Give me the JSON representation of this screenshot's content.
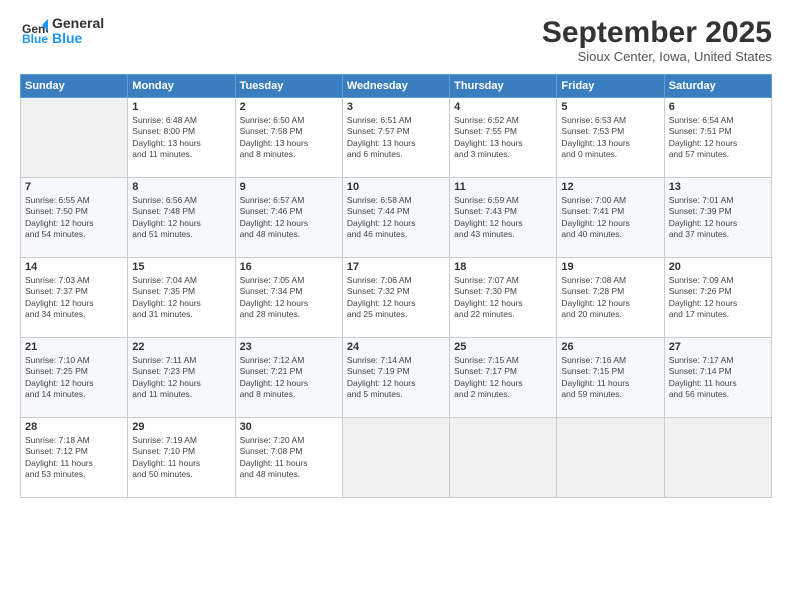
{
  "header": {
    "logo_line1": "General",
    "logo_line2": "Blue",
    "month_title": "September 2025",
    "subtitle": "Sioux Center, Iowa, United States"
  },
  "days_of_week": [
    "Sunday",
    "Monday",
    "Tuesday",
    "Wednesday",
    "Thursday",
    "Friday",
    "Saturday"
  ],
  "weeks": [
    [
      {
        "day": "",
        "info": ""
      },
      {
        "day": "1",
        "info": "Sunrise: 6:48 AM\nSunset: 8:00 PM\nDaylight: 13 hours\nand 11 minutes."
      },
      {
        "day": "2",
        "info": "Sunrise: 6:50 AM\nSunset: 7:58 PM\nDaylight: 13 hours\nand 8 minutes."
      },
      {
        "day": "3",
        "info": "Sunrise: 6:51 AM\nSunset: 7:57 PM\nDaylight: 13 hours\nand 6 minutes."
      },
      {
        "day": "4",
        "info": "Sunrise: 6:52 AM\nSunset: 7:55 PM\nDaylight: 13 hours\nand 3 minutes."
      },
      {
        "day": "5",
        "info": "Sunrise: 6:53 AM\nSunset: 7:53 PM\nDaylight: 13 hours\nand 0 minutes."
      },
      {
        "day": "6",
        "info": "Sunrise: 6:54 AM\nSunset: 7:51 PM\nDaylight: 12 hours\nand 57 minutes."
      }
    ],
    [
      {
        "day": "7",
        "info": "Sunrise: 6:55 AM\nSunset: 7:50 PM\nDaylight: 12 hours\nand 54 minutes."
      },
      {
        "day": "8",
        "info": "Sunrise: 6:56 AM\nSunset: 7:48 PM\nDaylight: 12 hours\nand 51 minutes."
      },
      {
        "day": "9",
        "info": "Sunrise: 6:57 AM\nSunset: 7:46 PM\nDaylight: 12 hours\nand 48 minutes."
      },
      {
        "day": "10",
        "info": "Sunrise: 6:58 AM\nSunset: 7:44 PM\nDaylight: 12 hours\nand 46 minutes."
      },
      {
        "day": "11",
        "info": "Sunrise: 6:59 AM\nSunset: 7:43 PM\nDaylight: 12 hours\nand 43 minutes."
      },
      {
        "day": "12",
        "info": "Sunrise: 7:00 AM\nSunset: 7:41 PM\nDaylight: 12 hours\nand 40 minutes."
      },
      {
        "day": "13",
        "info": "Sunrise: 7:01 AM\nSunset: 7:39 PM\nDaylight: 12 hours\nand 37 minutes."
      }
    ],
    [
      {
        "day": "14",
        "info": "Sunrise: 7:03 AM\nSunset: 7:37 PM\nDaylight: 12 hours\nand 34 minutes."
      },
      {
        "day": "15",
        "info": "Sunrise: 7:04 AM\nSunset: 7:35 PM\nDaylight: 12 hours\nand 31 minutes."
      },
      {
        "day": "16",
        "info": "Sunrise: 7:05 AM\nSunset: 7:34 PM\nDaylight: 12 hours\nand 28 minutes."
      },
      {
        "day": "17",
        "info": "Sunrise: 7:06 AM\nSunset: 7:32 PM\nDaylight: 12 hours\nand 25 minutes."
      },
      {
        "day": "18",
        "info": "Sunrise: 7:07 AM\nSunset: 7:30 PM\nDaylight: 12 hours\nand 22 minutes."
      },
      {
        "day": "19",
        "info": "Sunrise: 7:08 AM\nSunset: 7:28 PM\nDaylight: 12 hours\nand 20 minutes."
      },
      {
        "day": "20",
        "info": "Sunrise: 7:09 AM\nSunset: 7:26 PM\nDaylight: 12 hours\nand 17 minutes."
      }
    ],
    [
      {
        "day": "21",
        "info": "Sunrise: 7:10 AM\nSunset: 7:25 PM\nDaylight: 12 hours\nand 14 minutes."
      },
      {
        "day": "22",
        "info": "Sunrise: 7:11 AM\nSunset: 7:23 PM\nDaylight: 12 hours\nand 11 minutes."
      },
      {
        "day": "23",
        "info": "Sunrise: 7:12 AM\nSunset: 7:21 PM\nDaylight: 12 hours\nand 8 minutes."
      },
      {
        "day": "24",
        "info": "Sunrise: 7:14 AM\nSunset: 7:19 PM\nDaylight: 12 hours\nand 5 minutes."
      },
      {
        "day": "25",
        "info": "Sunrise: 7:15 AM\nSunset: 7:17 PM\nDaylight: 12 hours\nand 2 minutes."
      },
      {
        "day": "26",
        "info": "Sunrise: 7:16 AM\nSunset: 7:15 PM\nDaylight: 11 hours\nand 59 minutes."
      },
      {
        "day": "27",
        "info": "Sunrise: 7:17 AM\nSunset: 7:14 PM\nDaylight: 11 hours\nand 56 minutes."
      }
    ],
    [
      {
        "day": "28",
        "info": "Sunrise: 7:18 AM\nSunset: 7:12 PM\nDaylight: 11 hours\nand 53 minutes."
      },
      {
        "day": "29",
        "info": "Sunrise: 7:19 AM\nSunset: 7:10 PM\nDaylight: 11 hours\nand 50 minutes."
      },
      {
        "day": "30",
        "info": "Sunrise: 7:20 AM\nSunset: 7:08 PM\nDaylight: 11 hours\nand 48 minutes."
      },
      {
        "day": "",
        "info": ""
      },
      {
        "day": "",
        "info": ""
      },
      {
        "day": "",
        "info": ""
      },
      {
        "day": "",
        "info": ""
      }
    ]
  ]
}
